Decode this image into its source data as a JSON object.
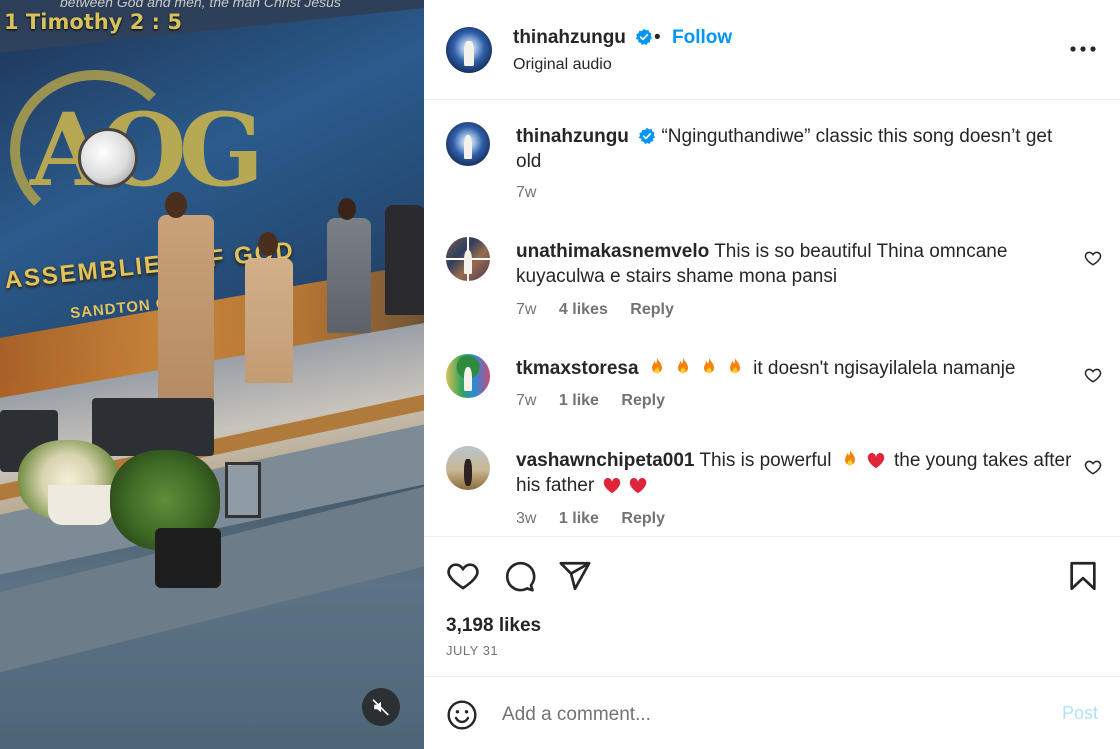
{
  "media": {
    "scripture_ref": "1 Timothy 2 : 5",
    "banner_top_text": "between God and men, the man Christ Jesus",
    "church_name": "ASSEMBLIES OF GOD",
    "church_location": "SANDTON C",
    "mute_icon": "speaker-muted-icon"
  },
  "header": {
    "username": "thinahzungu",
    "separator": "•",
    "follow_label": "Follow",
    "subtitle": "Original audio",
    "more_icon": "more-horizontal-icon"
  },
  "caption": {
    "username": "thinahzungu",
    "text": "“Nginguthandiwe” classic this song doesn’t get old",
    "time": "7w"
  },
  "comments": [
    {
      "username": "unathimakasnemvelo",
      "text": "This is so beautiful Thina omncane kuyaculwa e stairs shame mona pansi",
      "time": "7w",
      "likes": "4 likes",
      "reply": "Reply"
    },
    {
      "username": "tkmaxstoresa",
      "text_after_emoji": "it doesn't ngisayilalela namanje",
      "emoji": [
        "fire",
        "fire",
        "fire",
        "fire"
      ],
      "time": "7w",
      "likes": "1 like",
      "reply": "Reply"
    },
    {
      "username": "vashawnchipeta001",
      "text_1": "This is powerful",
      "text_2": "the young takes",
      "text_3": "after his father",
      "emoji": [
        "fire",
        "red-heart",
        "red-heart",
        "red-heart"
      ],
      "time": "3w",
      "likes": "1 like",
      "reply": "Reply"
    }
  ],
  "actions": {
    "icons": [
      "heart-icon",
      "comment-icon",
      "share-icon",
      "bookmark-icon"
    ],
    "likes": "3,198 likes",
    "date": "JULY 31"
  },
  "add_comment": {
    "placeholder": "Add a comment...",
    "post_label": "Post"
  },
  "colors": {
    "accent": "#0095f6",
    "verified": "#0095f6",
    "text": "#262626",
    "muted": "#737373",
    "post_disabled": "#b2dffc"
  }
}
